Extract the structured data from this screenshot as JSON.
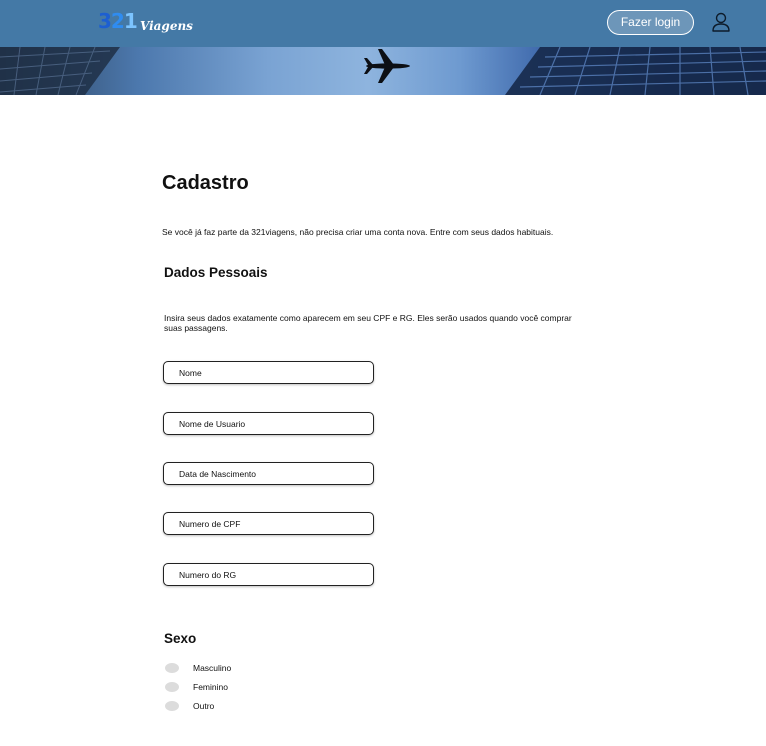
{
  "header": {
    "logo_number": {
      "d1": "3",
      "d2": "2",
      "d3": "1"
    },
    "logo_text": "Viagens",
    "login_label": "Fazer login",
    "user_icon": "user-icon"
  },
  "banner": {
    "image": "city-skyline-with-airplane"
  },
  "main": {
    "title": "Cadastro",
    "intro": "Se você já faz parte da 321viagens, não precisa criar uma conta nova. Entre com seus dados habituais.",
    "personal": {
      "title": "Dados Pessoais",
      "description": "Insira seus dados exatamente como aparecem em seu CPF e RG. Eles serão usados quando você comprar suas passagens.",
      "fields": [
        {
          "placeholder": "Nome",
          "value": ""
        },
        {
          "placeholder": "Nome de Usuario",
          "value": ""
        },
        {
          "placeholder": "Data de Nascimento",
          "value": ""
        },
        {
          "placeholder": "Numero de CPF",
          "value": ""
        },
        {
          "placeholder": "Numero do RG",
          "value": ""
        }
      ]
    },
    "sex": {
      "title": "Sexo",
      "options": [
        "Masculino",
        "Feminino",
        "Outro"
      ]
    }
  },
  "colors": {
    "header_bg": "#4479a6",
    "logo_blue_dark": "#1d5fd1",
    "logo_blue_light": "#7cc4ff",
    "radio_fill": "#dcdcdc"
  }
}
